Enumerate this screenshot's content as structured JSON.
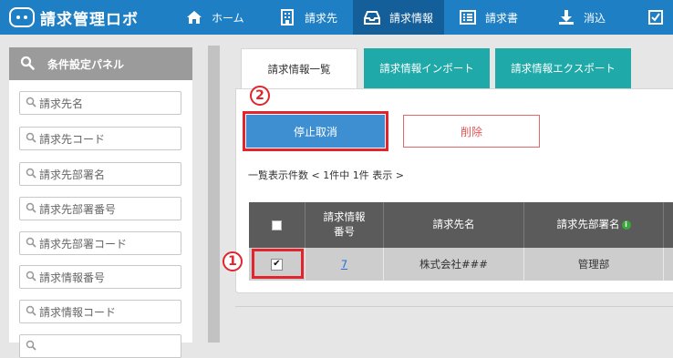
{
  "app": {
    "name": "請求管理ロボ"
  },
  "nav": {
    "items": [
      {
        "label": "ホーム",
        "icon": "home-icon"
      },
      {
        "label": "請求先",
        "icon": "building-icon"
      },
      {
        "label": "請求情報",
        "icon": "inbox-icon",
        "active": true
      },
      {
        "label": "請求書",
        "icon": "list-icon"
      },
      {
        "label": "消込",
        "icon": "download-icon"
      },
      {
        "label": "",
        "icon": "checkbox-icon"
      }
    ]
  },
  "sidebar": {
    "title": "条件設定パネル",
    "filters": [
      {
        "placeholder": "請求先名"
      },
      {
        "placeholder": "請求先コード"
      },
      {
        "placeholder": "請求先部署名"
      },
      {
        "placeholder": "請求先部署番号"
      },
      {
        "placeholder": "請求先部署コード"
      },
      {
        "placeholder": "請求情報番号"
      },
      {
        "placeholder": "請求情報コード"
      }
    ]
  },
  "tabs": [
    {
      "label": "請求情報一覧",
      "active": true
    },
    {
      "label": "請求情報インポート"
    },
    {
      "label": "請求情報エクスポート"
    }
  ],
  "actions": {
    "cancel_stop_label": "停止取消",
    "delete_label": "削除"
  },
  "annotations": {
    "step1": "1",
    "step2": "2"
  },
  "list": {
    "count_text": "一覧表示件数 < 1件中 1件 表示 >",
    "columns": [
      "請求情報\n番号",
      "請求先名",
      "請求先部署名"
    ],
    "rows": [
      {
        "checked": true,
        "number": "7",
        "customer": "株式会社###",
        "department": "管理部"
      }
    ]
  },
  "colors": {
    "nav_bg": "#1e7fc4",
    "nav_active": "#145e99",
    "primary_button": "#3d8fd2",
    "delete_border": "#e06a6a",
    "tab_teal": "#1fa9a8",
    "annotation_red": "#e0252e",
    "table_header": "#5b5b5b"
  }
}
